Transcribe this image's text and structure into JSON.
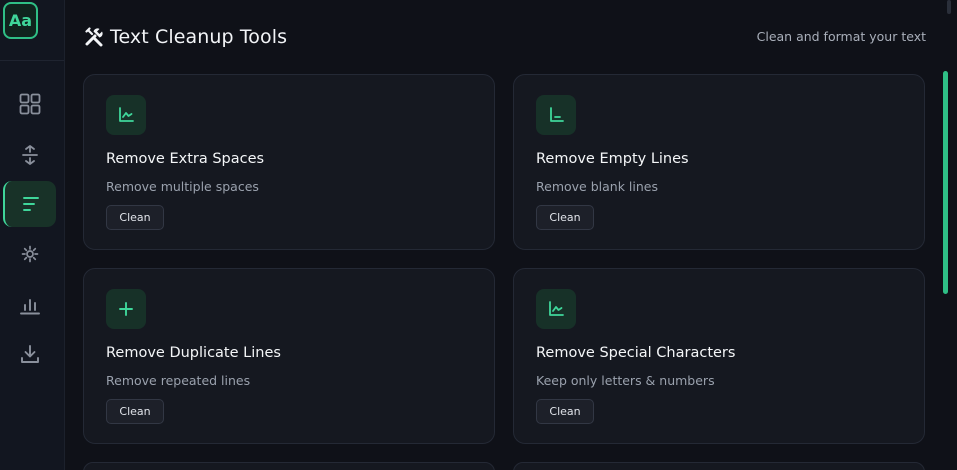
{
  "sidebar": {
    "logo": "Aa",
    "items": [
      {
        "icon": "grid-icon",
        "active": false
      },
      {
        "icon": "vertical-arrows-icon",
        "active": false
      },
      {
        "icon": "lines-icon",
        "active": true
      },
      {
        "icon": "sparkle-icon",
        "active": false
      },
      {
        "icon": "bar-chart-icon",
        "active": false
      },
      {
        "icon": "download-icon",
        "active": false
      }
    ]
  },
  "header": {
    "title": "Text Cleanup Tools",
    "title_icon": "tools-icon",
    "subtitle": "Clean and format your text"
  },
  "cards": [
    {
      "icon": "chart-icon",
      "title": "Remove Extra Spaces",
      "description": "Remove multiple spaces",
      "button": "Clean"
    },
    {
      "icon": "corner-icon",
      "title": "Remove Empty Lines",
      "description": "Remove blank lines",
      "button": "Clean"
    },
    {
      "icon": "plus-icon",
      "title": "Remove Duplicate Lines",
      "description": "Remove repeated lines",
      "button": "Clean"
    },
    {
      "icon": "chart-icon",
      "title": "Remove Special Characters",
      "description": "Keep only letters & numbers",
      "button": "Clean"
    }
  ],
  "colors": {
    "accent": "#3fd69a",
    "background": "#0f1118",
    "card": "#151820"
  }
}
